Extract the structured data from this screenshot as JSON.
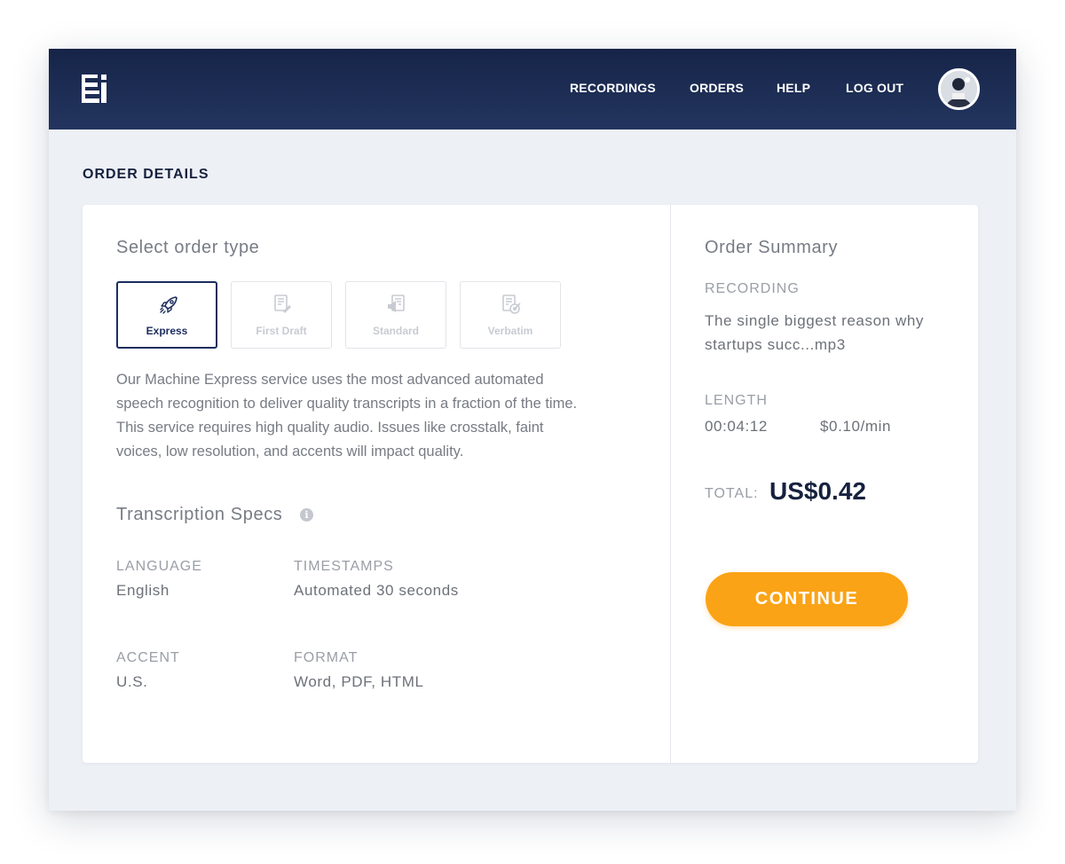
{
  "nav": {
    "items": [
      "RECORDINGS",
      "ORDERS",
      "HELP",
      "LOG OUT"
    ]
  },
  "page": {
    "title": "ORDER DETAILS"
  },
  "order": {
    "section_title": "Select order type",
    "types": [
      {
        "label": "Express",
        "icon": "rocket-icon",
        "selected": true
      },
      {
        "label": "First Draft",
        "icon": "document-pen-icon",
        "selected": false
      },
      {
        "label": "Standard",
        "icon": "document-megaphone-icon",
        "selected": false
      },
      {
        "label": "Verbatim",
        "icon": "document-target-icon",
        "selected": false
      }
    ],
    "description": "Our Machine Express service uses the most advanced automated speech recognition to deliver quality transcripts in a fraction of the time. This service requires high quality audio. Issues like crosstalk, faint voices, low resolution, and accents will impact quality."
  },
  "specs": {
    "title": "Transcription Specs",
    "info_icon": "i",
    "language": {
      "label": "LANGUAGE",
      "value": "English"
    },
    "timestamps": {
      "label": "TIMESTAMPS",
      "value": "Automated 30 seconds"
    },
    "accent": {
      "label": "ACCENT",
      "value": "U.S."
    },
    "format": {
      "label": "FORMAT",
      "value": "Word, PDF, HTML"
    }
  },
  "summary": {
    "title": "Order Summary",
    "recording_label": "RECORDING",
    "recording_line1": "The single biggest reason why",
    "recording_line2": "startups succ...mp3",
    "length_label": "LENGTH",
    "length_value": "00:04:12",
    "rate": "$0.10/min",
    "total_label": "TOTAL:",
    "total_value": "US$0.42",
    "continue_label": "CONTINUE"
  },
  "colors": {
    "header_top": "#162448",
    "header_bottom": "#23355f",
    "accent_orange": "#fba316",
    "selected_border": "#1c2d5e",
    "background": "#edf0f5"
  }
}
